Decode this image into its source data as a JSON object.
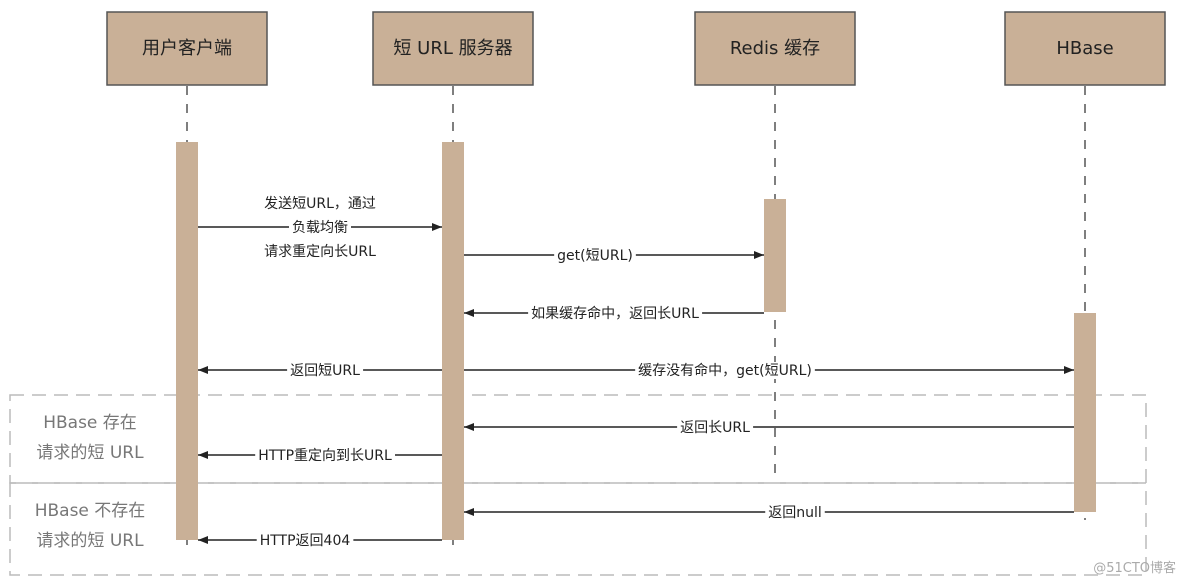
{
  "participants": [
    {
      "label": "用户客户端"
    },
    {
      "label": "短 URL 服务器"
    },
    {
      "label": "Redis 缓存"
    },
    {
      "label": "HBase"
    }
  ],
  "messages": [
    {
      "from": 0,
      "to": 1,
      "lines": [
        "发送短URL，通过",
        "负载均衡",
        "请求重定向长URL"
      ]
    },
    {
      "from": 1,
      "to": 2,
      "lines": [
        "get(短URL)"
      ]
    },
    {
      "from": 2,
      "to": 1,
      "lines": [
        "如果缓存命中，返回长URL"
      ]
    },
    {
      "from": 1,
      "to": 0,
      "lines": [
        "返回短URL"
      ]
    },
    {
      "from": 1,
      "to": 3,
      "lines": [
        "缓存没有命中，get(短URL)"
      ]
    },
    {
      "from": 3,
      "to": 1,
      "lines": [
        "返回长URL"
      ]
    },
    {
      "from": 1,
      "to": 0,
      "lines": [
        "HTTP重定向到长URL"
      ]
    },
    {
      "from": 3,
      "to": 1,
      "lines": [
        "返回null"
      ]
    },
    {
      "from": 1,
      "to": 0,
      "lines": [
        "HTTP返回404"
      ]
    }
  ],
  "frames": [
    {
      "lines": [
        "HBase 存在",
        "请求的短 URL"
      ]
    },
    {
      "lines": [
        "HBase 不存在",
        "请求的短 URL"
      ]
    }
  ],
  "watermark": "@51CTO博客",
  "colors": {
    "participant_fill": "#c9b097",
    "border": "#555555",
    "frame": "#bbbbbb"
  }
}
